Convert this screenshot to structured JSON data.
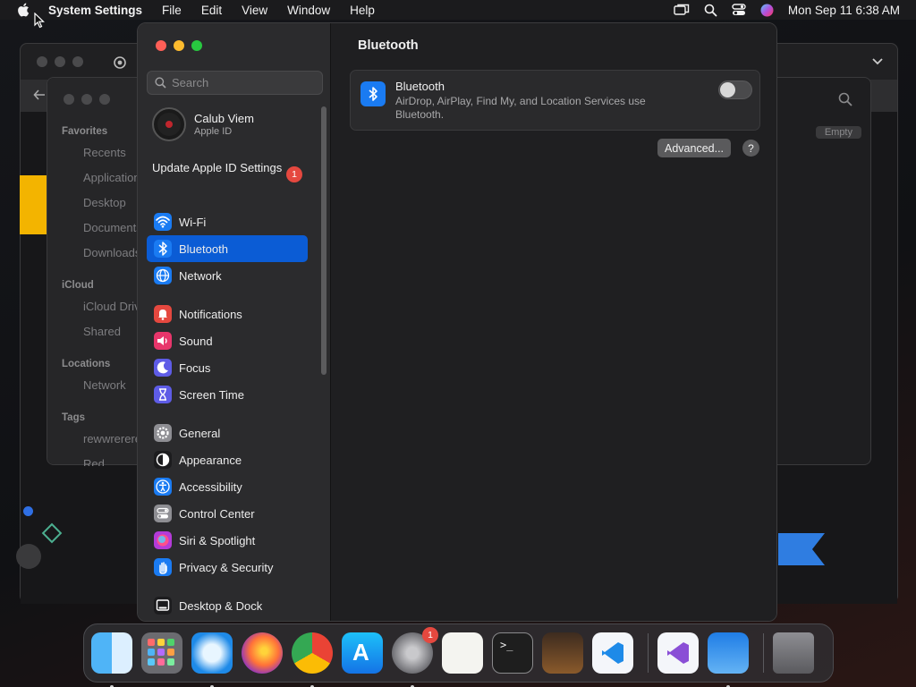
{
  "menubar": {
    "app_name": "System Settings",
    "menus": [
      "File",
      "Edit",
      "View",
      "Window",
      "Help"
    ],
    "clock": "Mon Sep 11  6:38 AM",
    "status_icons": [
      "screen-mirroring-icon",
      "spotlight-search-icon",
      "control-center-icon",
      "siri-icon"
    ]
  },
  "background_finder": {
    "sections": [
      {
        "title": "Favorites",
        "items": [
          "Recents",
          "Applications",
          "Desktop",
          "Documents",
          "Downloads"
        ]
      },
      {
        "title": "iCloud",
        "items": [
          "iCloud Drive",
          "Shared"
        ]
      },
      {
        "title": "Locations",
        "items": [
          "Network"
        ]
      },
      {
        "title": "Tags",
        "items": [
          "rewwrerere",
          "Red"
        ]
      }
    ],
    "empty_label": "Empty"
  },
  "settings": {
    "search_placeholder": "Search",
    "profile": {
      "name": "Calub Viem",
      "subtitle": "Apple ID"
    },
    "update_apple_id": {
      "label": "Update Apple ID Settings",
      "badge": "1"
    },
    "sidebar_groups": [
      [
        {
          "label": "Wi-Fi",
          "icon": "wifi-icon",
          "color": "#1a7bf2"
        },
        {
          "label": "Bluetooth",
          "icon": "bluetooth-icon",
          "color": "#1a7bf2",
          "selected": true
        },
        {
          "label": "Network",
          "icon": "globe-icon",
          "color": "#1a7bf2"
        }
      ],
      [
        {
          "label": "Notifications",
          "icon": "bell-icon",
          "color": "#e5483f"
        },
        {
          "label": "Sound",
          "icon": "speaker-icon",
          "color": "#e8366b"
        },
        {
          "label": "Focus",
          "icon": "moon-icon",
          "color": "#5e5ce6"
        },
        {
          "label": "Screen Time",
          "icon": "hourglass-icon",
          "color": "#5e5ce6"
        }
      ],
      [
        {
          "label": "General",
          "icon": "gear-icon",
          "color": "#8e8e93"
        },
        {
          "label": "Appearance",
          "icon": "appearance-icon",
          "color": "#1c1c1e"
        },
        {
          "label": "Accessibility",
          "icon": "accessibility-icon",
          "color": "#1a7bf2"
        },
        {
          "label": "Control Center",
          "icon": "control-center-icon",
          "color": "#8e8e93"
        },
        {
          "label": "Siri & Spotlight",
          "icon": "siri-icon",
          "color": "#b43bd8"
        },
        {
          "label": "Privacy & Security",
          "icon": "hand-icon",
          "color": "#1a7bf2"
        }
      ],
      [
        {
          "label": "Desktop & Dock",
          "icon": "dock-icon",
          "color": "#1c1c1e"
        }
      ]
    ],
    "main": {
      "title": "Bluetooth",
      "bluetooth_row": {
        "title": "Bluetooth",
        "description": "AirDrop, AirPlay, Find My, and Location Services use Bluetooth.",
        "enabled": false
      },
      "advanced_button": "Advanced...",
      "help_button": "?"
    }
  },
  "dock": {
    "apps": [
      {
        "name": "Finder",
        "icon": "finder-icon",
        "running": true
      },
      {
        "name": "Launchpad",
        "icon": "launchpad-icon",
        "running": false
      },
      {
        "name": "Safari",
        "icon": "safari-icon",
        "running": true
      },
      {
        "name": "Firefox",
        "icon": "firefox-icon",
        "running": false
      },
      {
        "name": "Google Chrome",
        "icon": "chrome-icon",
        "running": true
      },
      {
        "name": "App Store",
        "icon": "app-store-icon",
        "running": false
      },
      {
        "name": "System Settings",
        "icon": "system-settings-icon",
        "running": true,
        "badge": "1"
      },
      {
        "name": "TextEdit",
        "icon": "textedit-icon",
        "running": false
      },
      {
        "name": "Terminal",
        "icon": "terminal-icon",
        "running": false
      },
      {
        "name": "GarageBand",
        "icon": "garageband-icon",
        "running": false
      },
      {
        "name": "Visual Studio Code",
        "icon": "vscode-icon",
        "running": false
      },
      {
        "name": "Visual Studio",
        "icon": "visual-studio-icon",
        "running": false
      },
      {
        "name": "Weather",
        "icon": "weather-icon",
        "running": true
      },
      {
        "name": "Trash",
        "icon": "trash-icon",
        "running": false
      }
    ]
  }
}
